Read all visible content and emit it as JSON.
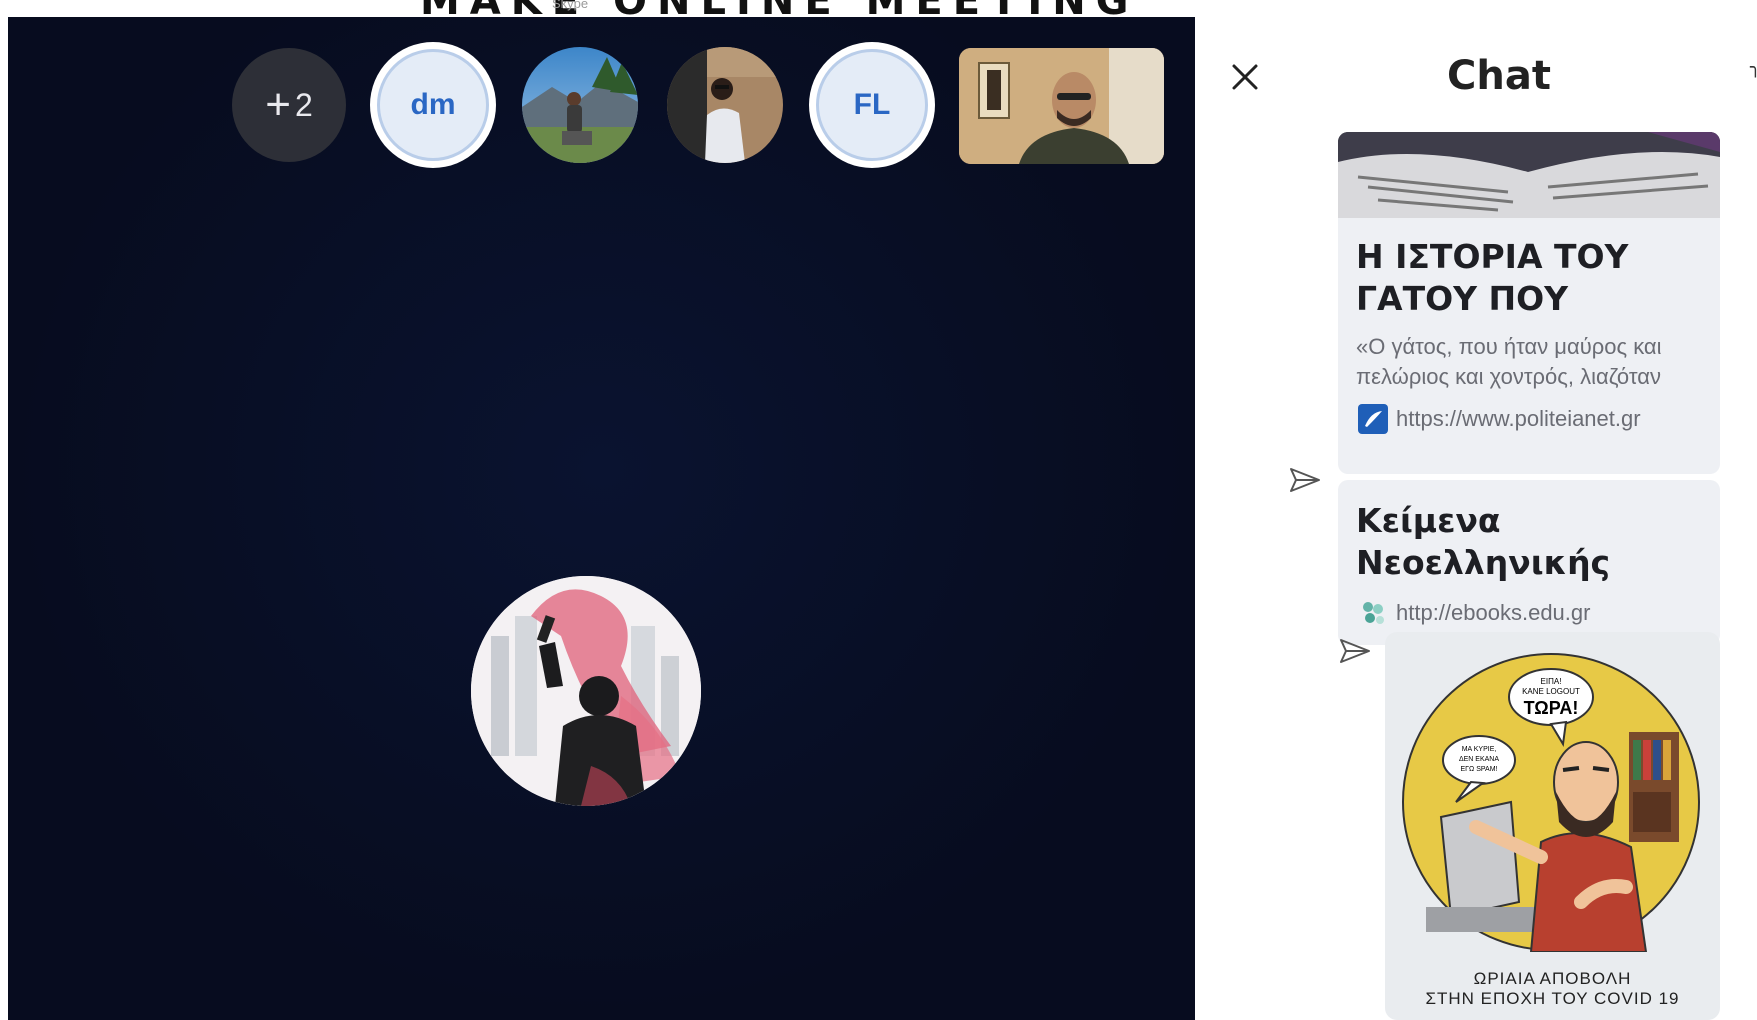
{
  "window": {
    "title_fragment": "MAKE ONLINE MEETING",
    "subtitle_fragment": "Skype"
  },
  "call": {
    "more_participants_count": "2",
    "participants": [
      {
        "initials": "dm"
      },
      {
        "initials": "FL"
      }
    ]
  },
  "chat": {
    "title": "Chat",
    "close_label": "Close",
    "messages": [
      {
        "title": "Η ΙΣΤΟΡΙΑ ΤΟΥ ΓΑΤΟΥ ΠΟΥ",
        "description_line1": "«Ο γάτος, που ήταν μαύρος και",
        "description_line2": "πελώριος και χοντρός, λιαζόταν",
        "url": "https://www.politeianet.gr"
      },
      {
        "title_line1": "Κείμενα",
        "title_line2": "Νεοελληνικής",
        "url": "http://ebooks.edu.gr"
      },
      {
        "image_alt": "comic",
        "bubble_top_line1": "ΕΙΠΑ!",
        "bubble_top_line2": "ΚΑΝΕ LOGOUT",
        "bubble_top_line3": "ΤΩΡΑ!",
        "bubble_left_line1": "ΜΑ ΚΥΡΙΕ,",
        "bubble_left_line2": "ΔΕΝ ΕΚΑΝΑ",
        "bubble_left_line3": "ΕΓΩ SPAM!",
        "caption_line1": "ΩΡΙΑΙΑ ΑΠΟΒΟΛΗ",
        "caption_line2": "ΣΤΗΝ ΕΠΟΧΗ ΤΟΥ COVID 19"
      }
    ]
  },
  "colors": {
    "stage_bg": "#070c1f",
    "initials_text": "#2a67c4",
    "card_bg": "#eef0f4"
  }
}
